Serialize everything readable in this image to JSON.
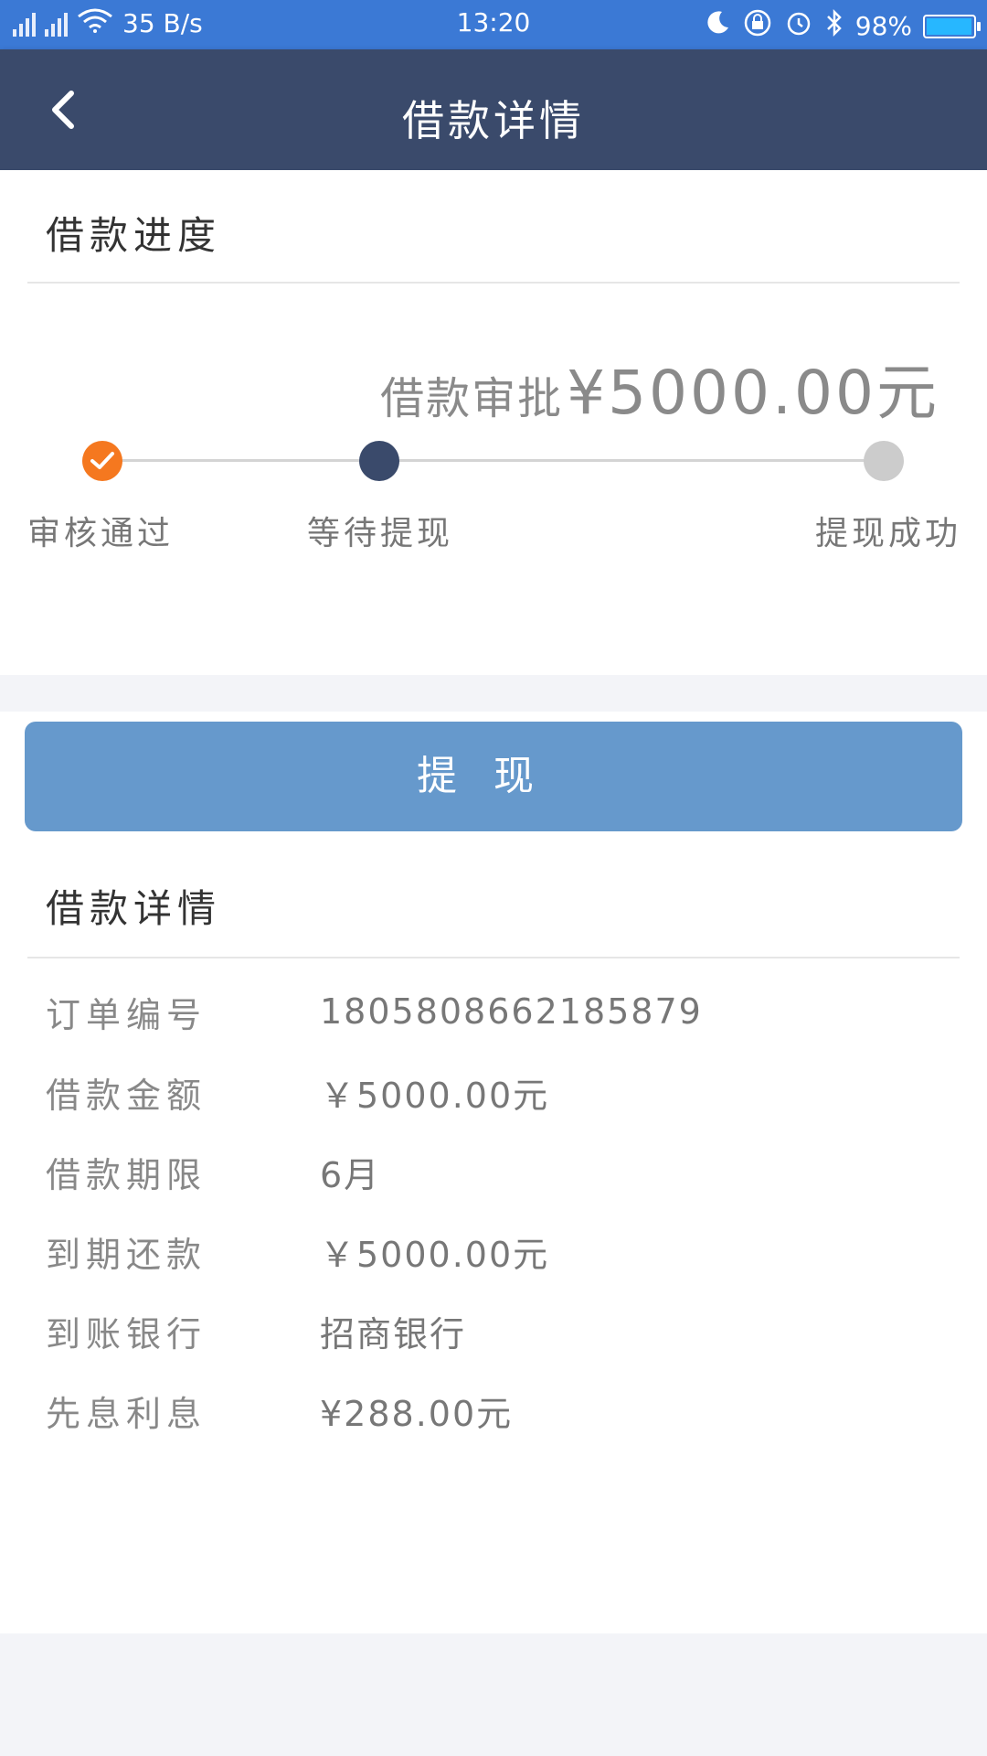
{
  "status_bar": {
    "network_speed": "35 B/s",
    "time": "13:20",
    "battery": "98%",
    "battery_level": 0.98
  },
  "header": {
    "title": "借款详情"
  },
  "progress": {
    "section_title": "借款进度",
    "amount_label": "借款审批",
    "amount_value": "¥5000.00元",
    "steps": [
      {
        "label": "审核通过",
        "state": "done"
      },
      {
        "label": "等待提现",
        "state": "current"
      },
      {
        "label": "提现成功",
        "state": "pending"
      }
    ]
  },
  "withdraw_button": {
    "label": "提现"
  },
  "details": {
    "section_title": "借款详情",
    "rows": [
      {
        "key": "订单编号",
        "value": "18058086621858​79"
      },
      {
        "key": "借款金额",
        "value": "￥5000.00元"
      },
      {
        "key": "借款期限",
        "value": "6月"
      },
      {
        "key": "到期还款",
        "value": "￥5000.00元"
      },
      {
        "key": "到账银行",
        "value": "招商银行"
      },
      {
        "key": "先息利息",
        "value": "¥288.00元"
      }
    ]
  },
  "colors": {
    "status_bar": "#3b79d5",
    "header": "#3a4a6b",
    "step_done": "#f5781f",
    "step_current": "#3a4a6b",
    "step_pending": "#cccccc",
    "button": "#6699cc"
  }
}
